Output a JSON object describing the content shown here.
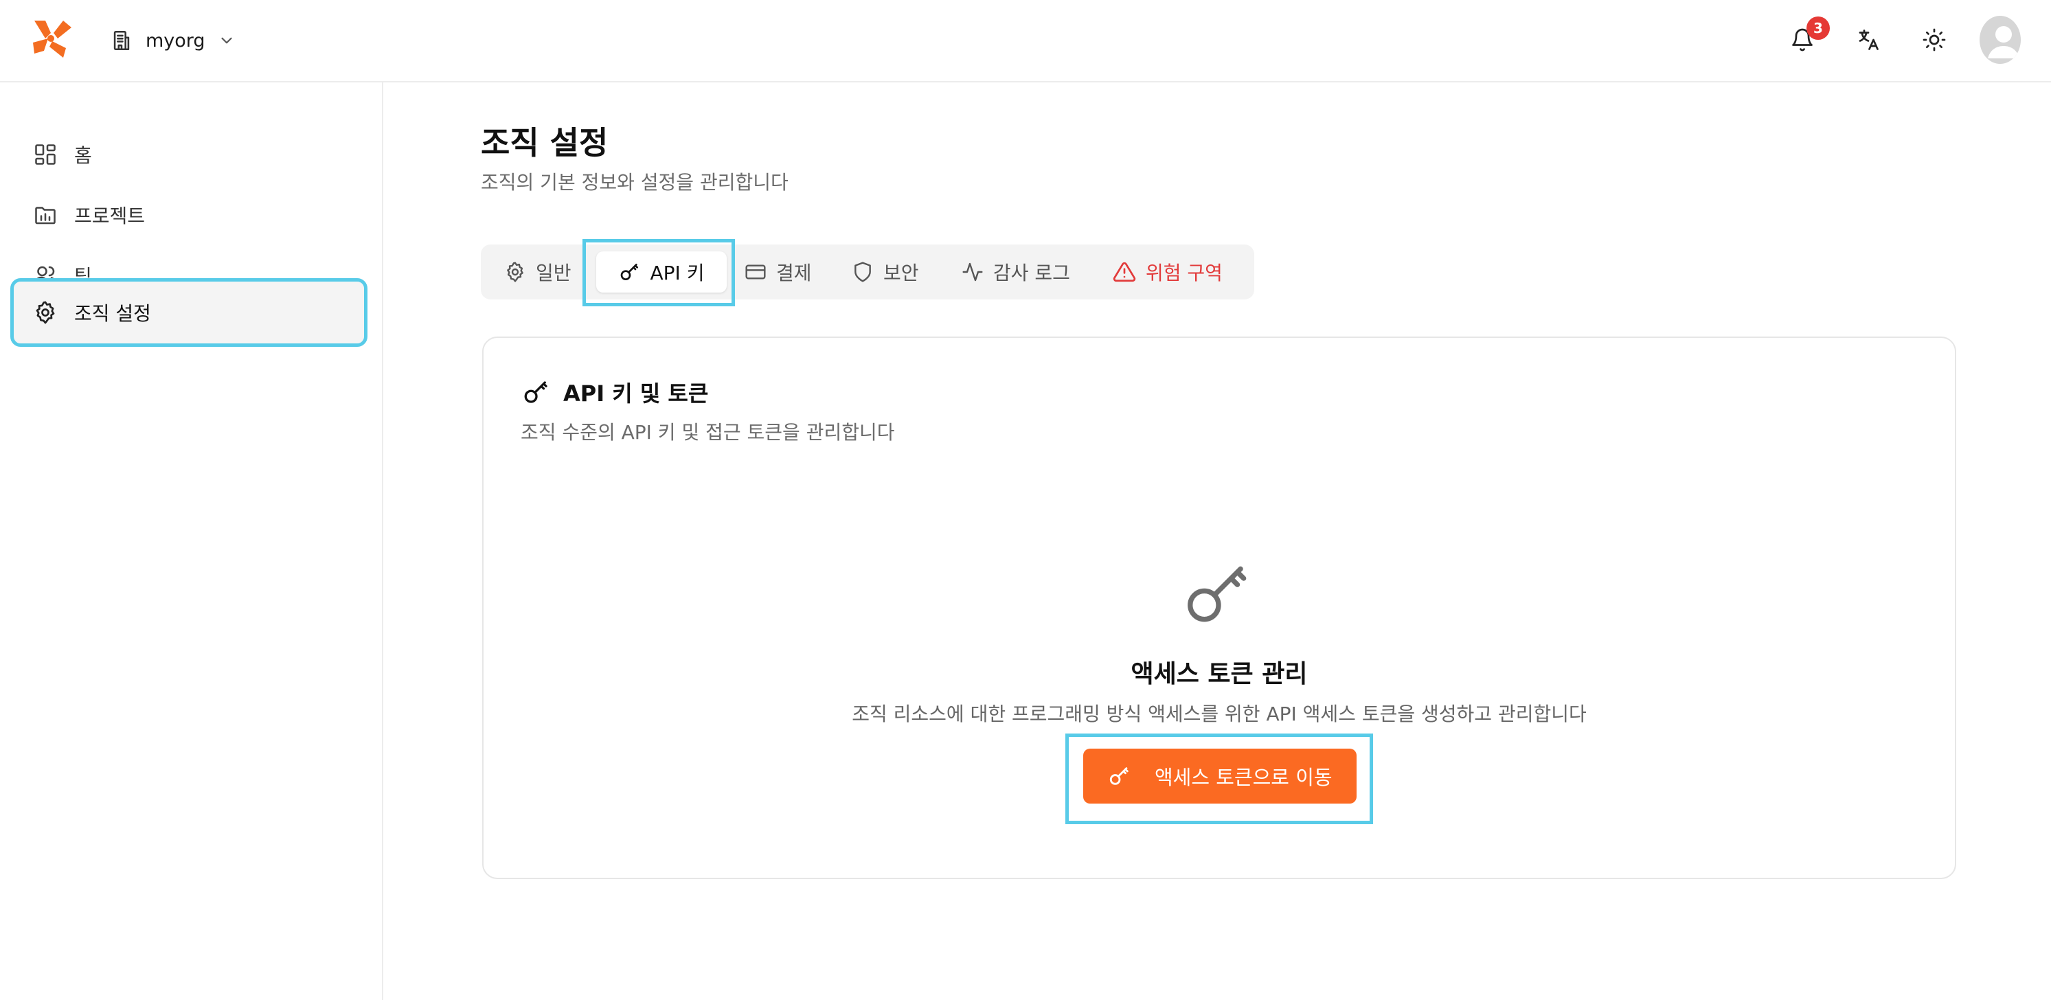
{
  "header": {
    "org_name": "myorg",
    "notification_count": "3",
    "icons": [
      "logo-icon",
      "building-icon",
      "chevron-down-icon",
      "bell-icon",
      "translate-icon",
      "sun-icon",
      "avatar"
    ]
  },
  "sidebar": {
    "items": [
      {
        "label": "홈",
        "icon": "dashboard-icon"
      },
      {
        "label": "프로젝트",
        "icon": "folder-icon"
      },
      {
        "label": "팀",
        "icon": "users-icon"
      },
      {
        "label": "조직 설정",
        "icon": "gear-icon",
        "active": true
      }
    ]
  },
  "page": {
    "title": "조직 설정",
    "subtitle": "조직의 기본 정보와 설정을 관리합니다"
  },
  "tabs": [
    {
      "label": "일반",
      "icon": "gear-icon"
    },
    {
      "label": "API 키",
      "icon": "key-icon",
      "active": true
    },
    {
      "label": "결제",
      "icon": "credit-card-icon"
    },
    {
      "label": "보안",
      "icon": "shield-icon"
    },
    {
      "label": "감사 로그",
      "icon": "activity-icon"
    },
    {
      "label": "위험 구역",
      "icon": "warning-icon",
      "danger": true
    }
  ],
  "card": {
    "title": "API 키 및 토큰",
    "subtitle": "조직 수준의 API 키 및 접근 토큰을 관리합니다",
    "empty_title": "액세스 토큰 관리",
    "empty_subtitle": "조직 리소스에 대한 프로그래밍 방식 액세스를 위한 API 액세스 토큰을 생성하고 관리합니다",
    "cta_label": "액세스 토큰으로 이동"
  },
  "colors": {
    "accent": "#fb6a22",
    "danger": "#e23a3a",
    "badge": "#e53935",
    "highlight": "#58cbe8"
  }
}
